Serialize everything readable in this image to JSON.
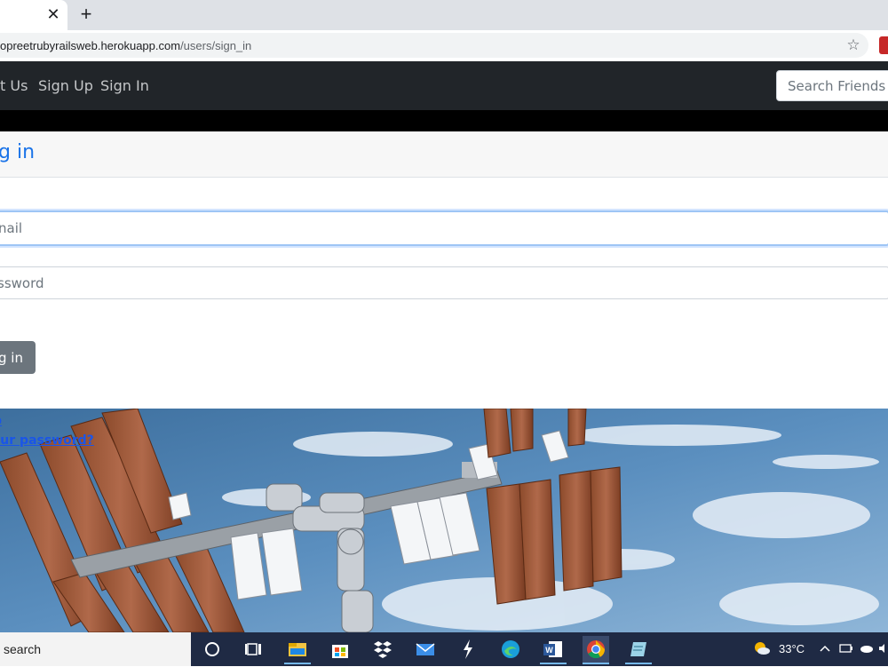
{
  "browser": {
    "tab_close_glyph": "✕",
    "new_tab_glyph": "+",
    "url_host": "opreetrubyrailsweb.herokuapp.com",
    "url_path": "/users/sign_in",
    "star_glyph": "☆",
    "star_icon": "bookmark-star-icon",
    "extension_icon": "pdf-extension-icon"
  },
  "navbar": {
    "links": [
      {
        "label": "t Us"
      },
      {
        "label": "Sign Up"
      },
      {
        "label": "Sign In"
      }
    ],
    "search_placeholder": "Search Friends"
  },
  "signin": {
    "title": "g in",
    "email_placeholder": "nail",
    "password_placeholder": "ssword",
    "submit_label": "g in",
    "links": [
      {
        "label": "p"
      },
      {
        "label": "t your password?"
      }
    ]
  },
  "taskbar": {
    "search_text": "search",
    "apps": [
      {
        "name": "cortana-icon"
      },
      {
        "name": "task-view-icon"
      },
      {
        "name": "file-explorer-icon"
      },
      {
        "name": "microsoft-store-icon"
      },
      {
        "name": "dropbox-icon"
      },
      {
        "name": "mail-icon"
      },
      {
        "name": "app-bolt-icon"
      },
      {
        "name": "edge-icon"
      },
      {
        "name": "word-icon"
      },
      {
        "name": "chrome-icon"
      },
      {
        "name": "notepad-icon"
      }
    ],
    "temperature": "33°C",
    "weather_icon": "partly-sunny-icon"
  },
  "colors": {
    "navbar_bg": "#212529",
    "heading": "#1a73e8",
    "button_bg": "#6c757d",
    "taskbar_bg": "#1f2a44"
  }
}
